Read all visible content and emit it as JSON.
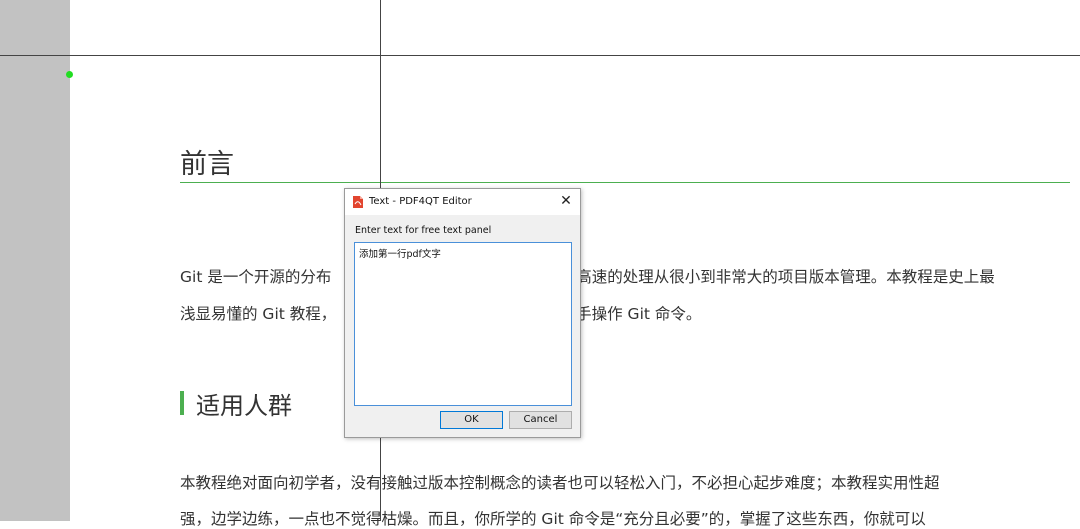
{
  "document": {
    "heading1": "前言",
    "para1_line1_left": "Git 是一个开源的分布",
    "para1_line1_right": "高速的处理从很小到非常大的项目版本管理。本教程是史上最",
    "para1_line2_left": "浅显易懂的 Git 教程，",
    "para1_line2_right": "手操作 Git 命令。",
    "heading2": "适用人群",
    "para2_line1": "本教程绝对面向初学者，没有接触过版本控制概念的读者也可以轻松入门，不必担心起步难度；本教程实用性超",
    "para2_line2": "强，边学边练，一点也不觉得枯燥。而且，你所学的 Git 命令是“充分且必要”的，掌握了这些东西，你就可以"
  },
  "dialog": {
    "title": "Text - PDF4QT Editor",
    "prompt": "Enter text for free text panel",
    "text_value": "添加第一行pdf文字",
    "ok_label": "OK",
    "cancel_label": "Cancel",
    "close_glyph": "✕"
  },
  "colors": {
    "accent_green": "#4caf50",
    "focus_blue": "#0078d7"
  },
  "icons": {
    "app": "pdf-app-icon",
    "close": "close-icon"
  }
}
